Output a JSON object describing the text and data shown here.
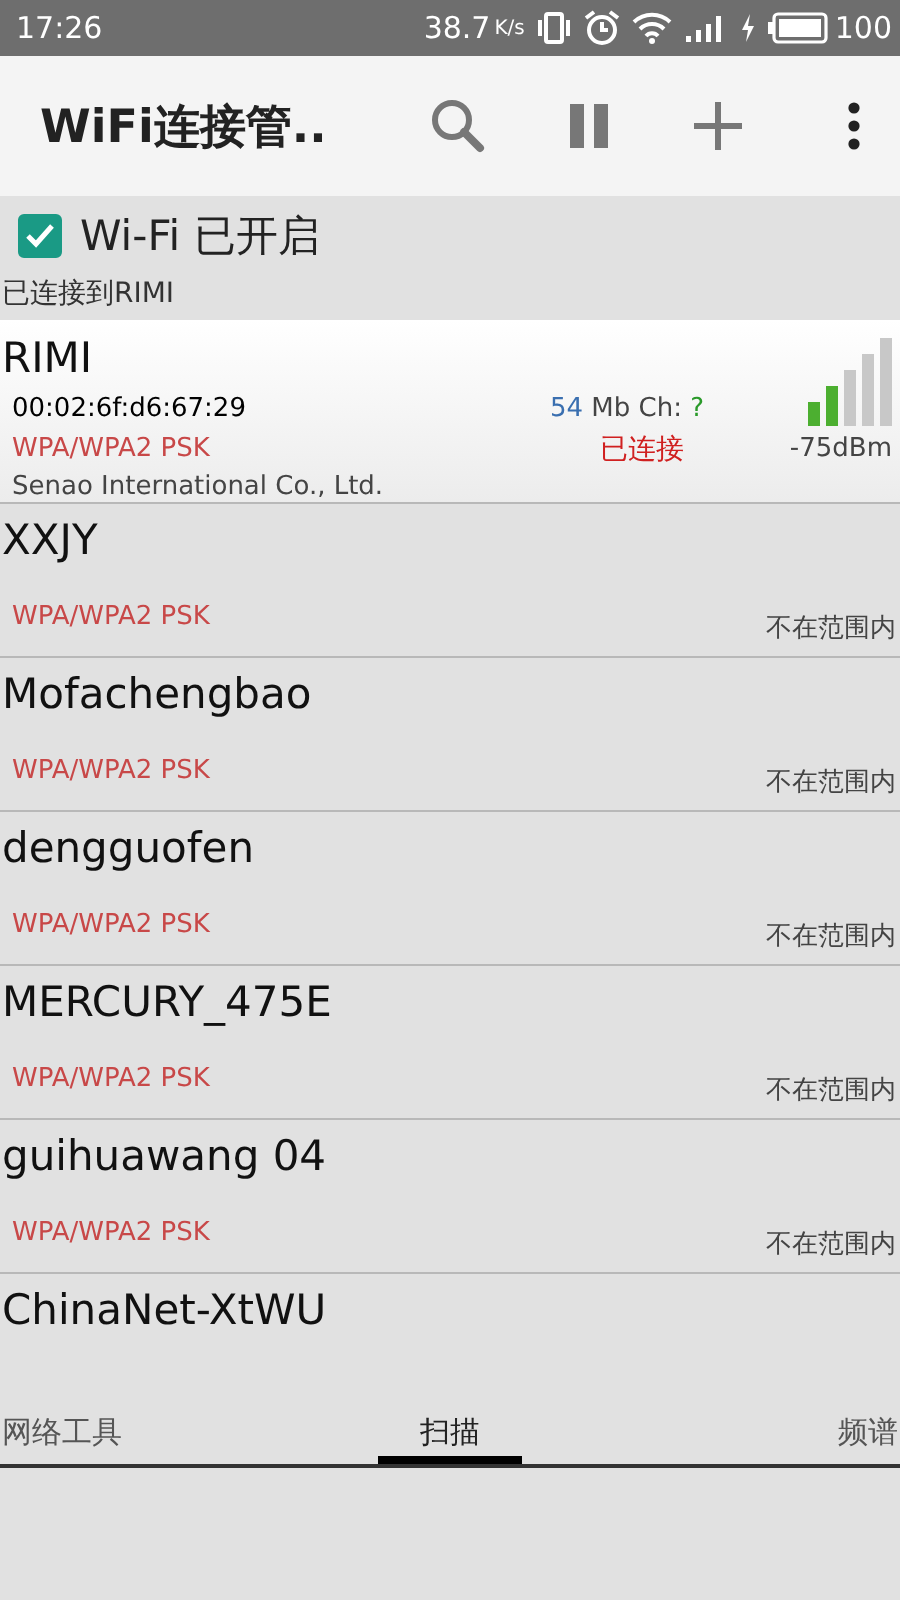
{
  "status_bar": {
    "time": "17:26",
    "speed": "38.7",
    "speed_unit": "K/s",
    "battery": "100"
  },
  "toolbar": {
    "title": "WiFi连接管.."
  },
  "wifi_toggle": {
    "label": "Wi-Fi 已开启",
    "checked": true
  },
  "connection_note": "已连接到RIMI",
  "networks": [
    {
      "kind": "connected",
      "name": "RIMI",
      "mac": "00:02:6f:d6:67:29",
      "rate": "54",
      "rate_unit": "Mb",
      "channel_label": "Ch:",
      "channel": "?",
      "security": "WPA/WPA2 PSK",
      "status": "已连接",
      "vendor": "Senao International Co., Ltd.",
      "signal": "-75dBm"
    },
    {
      "kind": "saved",
      "name": "XXJY",
      "security": "WPA/WPA2 PSK",
      "status": "不在范围内"
    },
    {
      "kind": "saved",
      "name": "Mofachengbao",
      "security": "WPA/WPA2 PSK",
      "status": "不在范围内"
    },
    {
      "kind": "saved",
      "name": "dengguofen",
      "security": "WPA/WPA2 PSK",
      "status": "不在范围内"
    },
    {
      "kind": "saved",
      "name": "MERCURY_475E",
      "security": "WPA/WPA2 PSK",
      "status": "不在范围内"
    },
    {
      "kind": "saved",
      "name": "guihuawang 04",
      "security": "WPA/WPA2 PSK",
      "status": "不在范围内"
    },
    {
      "kind": "partial",
      "name": "ChinaNet-XtWU"
    }
  ],
  "tabs": [
    {
      "label": "网络工具",
      "selected": false
    },
    {
      "label": "扫描",
      "selected": true
    },
    {
      "label": "频谱",
      "selected": false
    }
  ]
}
